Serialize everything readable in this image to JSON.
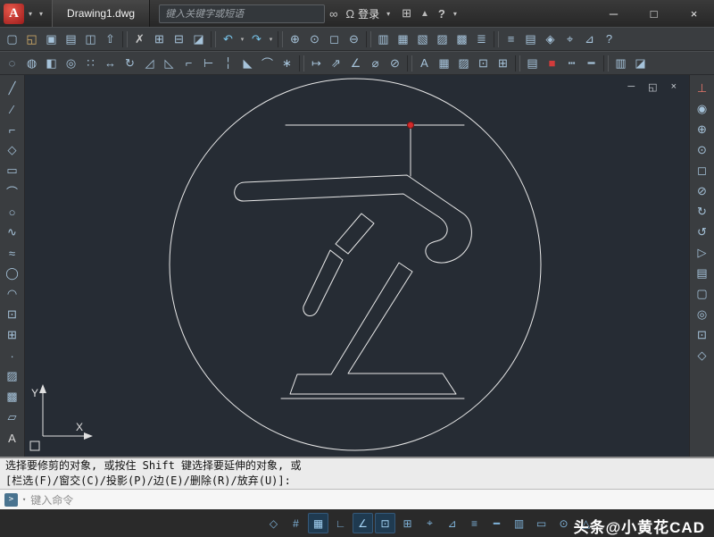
{
  "titlebar": {
    "logo_letter": "A",
    "app_menu_arrow": "▾",
    "qat_arrow": "▾",
    "tab_label": "Drawing1.dwg",
    "search_placeholder": "键入关键字或短语",
    "search_button_glyph": "∞",
    "signin_person_glyph": "Ω",
    "signin_label": "登录",
    "signin_arrow": "▾",
    "cart_glyph": "⊞",
    "apps_glyph": "▲",
    "help_glyph": "?",
    "help_arrow": "▾",
    "minimize_glyph": "─",
    "maximize_glyph": "□",
    "close_glyph": "×"
  },
  "doc_window": {
    "minimize_glyph": "─",
    "restore_glyph": "◱",
    "close_glyph": "×"
  },
  "toolbars": {
    "row1": [
      {
        "name": "qnew-icon",
        "glyph": "▢"
      },
      {
        "name": "open-icon",
        "glyph": "◱",
        "c": "#d9b26a"
      },
      {
        "name": "save-icon",
        "glyph": "▣"
      },
      {
        "name": "plot-icon",
        "glyph": "▤"
      },
      {
        "name": "plot-preview-icon",
        "glyph": "◫"
      },
      {
        "name": "publish-icon",
        "glyph": "⇧"
      },
      {
        "name": "separator",
        "glyph": "",
        "cls": "sep",
        "interactable": false
      },
      {
        "name": "cut-icon",
        "glyph": "✗",
        "c": "#c9c9c9"
      },
      {
        "name": "copy-clip-icon",
        "glyph": "⊞"
      },
      {
        "name": "paste-icon",
        "glyph": "⊟"
      },
      {
        "name": "match-properties-icon",
        "glyph": "◪"
      },
      {
        "name": "separator",
        "glyph": "",
        "cls": "sep",
        "interactable": false
      },
      {
        "name": "undo-icon",
        "glyph": "↶",
        "c": "#79c7ee"
      },
      {
        "name": "undo-dropdown-icon",
        "glyph": "▾",
        "cls": "dd"
      },
      {
        "name": "redo-icon",
        "glyph": "↷",
        "c": "#79c7ee"
      },
      {
        "name": "redo-dropdown-icon",
        "glyph": "▾",
        "cls": "dd"
      },
      {
        "name": "separator",
        "glyph": "",
        "cls": "sep",
        "interactable": false
      },
      {
        "name": "pan-icon",
        "glyph": "⊕"
      },
      {
        "name": "zoom-realtime-icon",
        "glyph": "⊙"
      },
      {
        "name": "zoom-window-icon",
        "glyph": "◻"
      },
      {
        "name": "zoom-previous-icon",
        "glyph": "⊖"
      },
      {
        "name": "separator",
        "glyph": "",
        "cls": "sep",
        "interactable": false
      },
      {
        "name": "properties-icon",
        "glyph": "▥"
      },
      {
        "name": "designcenter-icon",
        "glyph": "▦"
      },
      {
        "name": "tool-palettes-icon",
        "glyph": "▧"
      },
      {
        "name": "sheet-set-manager-icon",
        "glyph": "▨"
      },
      {
        "name": "markup-icon",
        "glyph": "▩"
      },
      {
        "name": "quickcalc-icon",
        "glyph": "≣"
      },
      {
        "name": "separator",
        "glyph": "",
        "cls": "sep",
        "interactable": false
      },
      {
        "name": "layer-properties-icon",
        "glyph": "≡"
      },
      {
        "name": "layer-states-icon",
        "glyph": "▤"
      },
      {
        "name": "workspaces-icon",
        "glyph": "◈"
      },
      {
        "name": "osnap-settings-icon",
        "glyph": "⌖"
      },
      {
        "name": "measure-icon",
        "glyph": "⊿"
      },
      {
        "name": "help-icon",
        "glyph": "?"
      }
    ],
    "row2": [
      {
        "name": "erase-icon",
        "glyph": "◌"
      },
      {
        "name": "copy-object-icon",
        "glyph": "◍"
      },
      {
        "name": "mirror-icon",
        "glyph": "◧"
      },
      {
        "name": "offset-icon",
        "glyph": "◎"
      },
      {
        "name": "array-icon",
        "glyph": "∷"
      },
      {
        "name": "move-icon",
        "glyph": "↔"
      },
      {
        "name": "rotate-icon",
        "glyph": "↻"
      },
      {
        "name": "scale-icon",
        "glyph": "◿"
      },
      {
        "name": "stretch-icon",
        "glyph": "◺"
      },
      {
        "name": "trim-icon",
        "glyph": "⌐"
      },
      {
        "name": "extend-icon",
        "glyph": "⊢"
      },
      {
        "name": "break-icon",
        "glyph": "╎"
      },
      {
        "name": "chamfer-icon",
        "glyph": "◣"
      },
      {
        "name": "fillet-icon",
        "glyph": "⌒"
      },
      {
        "name": "explode-icon",
        "glyph": "∗"
      },
      {
        "name": "separator",
        "glyph": "",
        "cls": "sep",
        "interactable": false
      },
      {
        "name": "dim-linear-icon",
        "glyph": "↦"
      },
      {
        "name": "dim-aligned-icon",
        "glyph": "⇗"
      },
      {
        "name": "dim-angular-icon",
        "glyph": "∠"
      },
      {
        "name": "dim-radius-icon",
        "glyph": "⌀"
      },
      {
        "name": "dim-diameter-icon",
        "glyph": "⊘"
      },
      {
        "name": "separator",
        "glyph": "",
        "cls": "sep",
        "interactable": false
      },
      {
        "name": "mtext-icon",
        "glyph": "A"
      },
      {
        "name": "table-icon",
        "glyph": "▦"
      },
      {
        "name": "hatch-icon",
        "glyph": "▨"
      },
      {
        "name": "insert-block-icon",
        "glyph": "⊡"
      },
      {
        "name": "create-block-icon",
        "glyph": "⊞"
      },
      {
        "name": "separator",
        "glyph": "",
        "cls": "sep",
        "interactable": false
      },
      {
        "name": "layer-control-icon",
        "glyph": "▤"
      },
      {
        "name": "color-control-icon",
        "glyph": "■",
        "c": "#d23b3b"
      },
      {
        "name": "linetype-icon",
        "glyph": "┅"
      },
      {
        "name": "lineweight-icon",
        "glyph": "━"
      },
      {
        "name": "separator",
        "glyph": "",
        "cls": "sep",
        "interactable": false
      },
      {
        "name": "properties-palette-icon",
        "glyph": "▥"
      },
      {
        "name": "match-properties2-icon",
        "glyph": "◪"
      }
    ],
    "left": [
      {
        "name": "line-icon",
        "glyph": "╱"
      },
      {
        "name": "construction-line-icon",
        "glyph": "∕"
      },
      {
        "name": "polyline-icon",
        "glyph": "⌐"
      },
      {
        "name": "polygon-icon",
        "glyph": "◇"
      },
      {
        "name": "rectangle-icon",
        "glyph": "▭"
      },
      {
        "name": "arc-icon",
        "glyph": "⌒"
      },
      {
        "name": "circle-icon",
        "glyph": "○"
      },
      {
        "name": "revision-cloud-icon",
        "glyph": "∿"
      },
      {
        "name": "spline-icon",
        "glyph": "≈"
      },
      {
        "name": "ellipse-icon",
        "glyph": "◯"
      },
      {
        "name": "ellipse-arc-icon",
        "glyph": "◠"
      },
      {
        "name": "insert-block-icon",
        "glyph": "⊡"
      },
      {
        "name": "create-block-icon",
        "glyph": "⊞"
      },
      {
        "name": "point-icon",
        "glyph": "∙"
      },
      {
        "name": "hatch-icon",
        "glyph": "▨"
      },
      {
        "name": "gradient-icon",
        "glyph": "▩"
      },
      {
        "name": "region-icon",
        "glyph": "▱"
      },
      {
        "name": "mtext-icon",
        "glyph": "A",
        "c": "#d8d8d8"
      }
    ],
    "right": [
      {
        "name": "ucs-tool-icon",
        "glyph": "⊥",
        "c": "#e3756b"
      },
      {
        "name": "full-navigation-wheel-icon",
        "glyph": "◉"
      },
      {
        "name": "pan-hand-icon",
        "glyph": "⊕"
      },
      {
        "name": "zoom-extents-icon",
        "glyph": "⊙"
      },
      {
        "name": "zoom-window-icon",
        "glyph": "◻"
      },
      {
        "name": "zoom-realtime-icon",
        "glyph": "⊘"
      },
      {
        "name": "orbit-icon",
        "glyph": "↻"
      },
      {
        "name": "free-orbit-icon",
        "glyph": "↺"
      },
      {
        "name": "showmotion-icon",
        "glyph": "▷"
      },
      {
        "name": "layer-walk-icon",
        "glyph": "▤"
      },
      {
        "name": "named-views-icon",
        "glyph": "▢"
      },
      {
        "name": "steering-wheels-icon",
        "glyph": "◎"
      },
      {
        "name": "object-snap-icon",
        "glyph": "⊡"
      },
      {
        "name": "constraints-icon",
        "glyph": "◇"
      }
    ]
  },
  "command": {
    "history_line1": "选择要修剪的对象, 或按住 Shift 键选择要延伸的对象, 或",
    "history_line2": "[栏选(F)/窗交(C)/投影(P)/边(E)/删除(R)/放弃(U)]:",
    "prompt_glyph": ">",
    "prompt_arrow": "▾",
    "input_placeholder": "键入命令"
  },
  "statusbar": {
    "watermark": "头条@小黄花CAD",
    "icons": [
      {
        "name": "infer-constraints-icon",
        "glyph": "◇"
      },
      {
        "name": "snap-mode-icon",
        "glyph": "#"
      },
      {
        "name": "grid-display-icon",
        "glyph": "▦",
        "cls": "on"
      },
      {
        "name": "ortho-mode-icon",
        "glyph": "∟"
      },
      {
        "name": "polar-tracking-icon",
        "glyph": "∠",
        "cls": "on"
      },
      {
        "name": "object-snap-icon",
        "glyph": "⊡",
        "cls": "on"
      },
      {
        "name": "object-snap-3d-icon",
        "glyph": "⊞"
      },
      {
        "name": "object-snap-tracking-icon",
        "glyph": "⌖"
      },
      {
        "name": "dynamic-ucs-icon",
        "glyph": "⊿"
      },
      {
        "name": "dynamic-input-icon",
        "glyph": "≡"
      },
      {
        "name": "lineweight-display-icon",
        "glyph": "━"
      },
      {
        "name": "transparency-icon",
        "glyph": "▥"
      },
      {
        "name": "quick-properties-icon",
        "glyph": "▭"
      },
      {
        "name": "selection-cycling-icon",
        "glyph": "⊙"
      },
      {
        "name": "annotation-monitor-icon",
        "glyph": "△"
      }
    ]
  },
  "ucs": {
    "x_label": "X",
    "y_label": "Y"
  },
  "colors": {
    "canvas_bg": "#262c34",
    "entity_line": "#e9e9e9",
    "grip_red": "#d42a2a",
    "toolbar_bg": "#3a3d40",
    "titlebar_bg": "#2f2f2f",
    "command_bg": "#ebebeb"
  }
}
